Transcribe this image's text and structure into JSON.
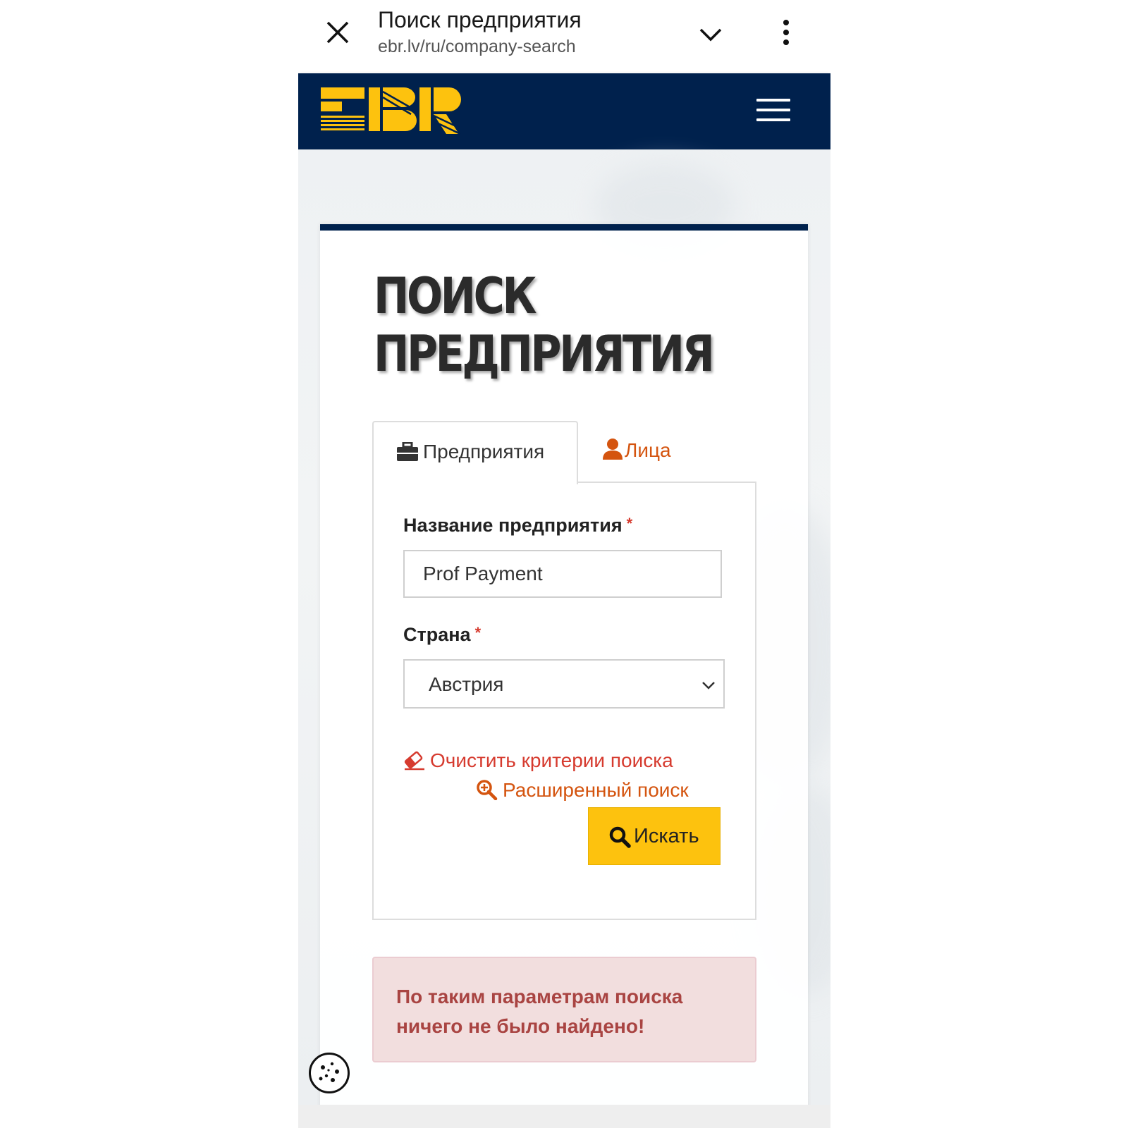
{
  "browser": {
    "title": "Поиск предприятия",
    "url": "ebr.lv/ru/company-search"
  },
  "site": {
    "logo_text": "EBR",
    "brand_color": "#fdc20e",
    "header_color": "#00214d"
  },
  "page": {
    "heading_line1": "ПОИСК",
    "heading_line2": "ПРЕДПРИЯТИЯ"
  },
  "tabs": [
    {
      "label": "Предприятия",
      "icon": "briefcase-icon",
      "active": true
    },
    {
      "label": "Лица",
      "icon": "person-icon",
      "active": false
    }
  ],
  "form": {
    "company_label": "Название предприятия",
    "company_value": "Prof Payment",
    "required_mark": "*",
    "country_label": "Страна",
    "country_value": "Австрия",
    "clear_link": "Очистить критерии поиска",
    "advanced_link": "Расширенный поиск",
    "search_button": "Искать"
  },
  "alert": {
    "message": "По таким параметрам поиска ничего не было найдено!"
  }
}
